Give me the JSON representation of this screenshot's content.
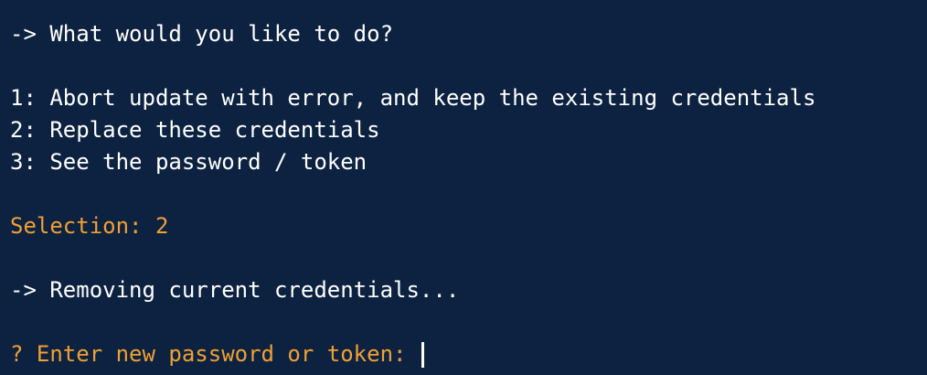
{
  "terminal": {
    "question": "-> What would you like to do?",
    "options": [
      "1: Abort update with error, and keep the existing credentials",
      "2: Replace these credentials",
      "3: See the password / token"
    ],
    "selection": "Selection: 2",
    "status": "-> Removing current credentials...",
    "prompt": "? Enter new password or token: ",
    "colors": {
      "background": "#0c2240",
      "text": "#ffffff",
      "accent": "#f0a034"
    }
  }
}
